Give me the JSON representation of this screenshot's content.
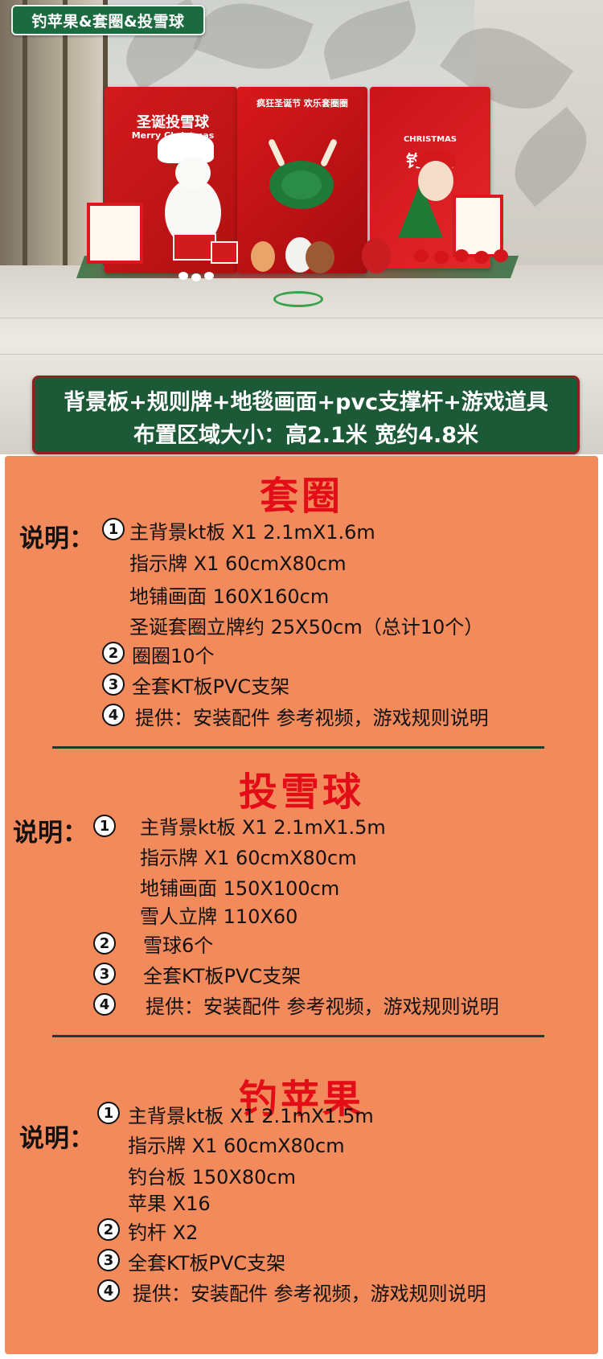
{
  "title_chip": "钓苹果&套圈&投雪球",
  "photo": {
    "board_left_title": "圣诞投雪球",
    "board_left_sub": "Merry Christmas",
    "board_mid_title": "疯狂圣诞节 欢乐套圈圈",
    "board_right_top": "CHRISTMAS",
    "board_right_title": "钓苹果"
  },
  "banner": {
    "line1": "背景板+规则牌+地毯画面+pvc支撑杆+游戏道具",
    "line2": "布置区域大小：高2.1米  宽约4.8米"
  },
  "sections": [
    {
      "title": "套圈",
      "label": "说明：",
      "items": [
        {
          "num": "1",
          "text": "主背景kt板 X1   2.1mX1.6m"
        },
        {
          "num": "",
          "text": "指示牌 X1         60cmX80cm"
        },
        {
          "num": "",
          "text": "地铺画面  160X160cm"
        },
        {
          "num": "",
          "text": "圣诞套圈立牌约  25X50cm（总计10个）"
        },
        {
          "num": "2",
          "text": "圈圈10个"
        },
        {
          "num": "3",
          "text": "全套KT板PVC支架"
        },
        {
          "num": "4",
          "text": "提供：安装配件  参考视频，游戏规则说明"
        }
      ]
    },
    {
      "title": "投雪球",
      "label": "说明：",
      "items": [
        {
          "num": "1",
          "text": "主背景kt板 X1   2.1mX1.5m"
        },
        {
          "num": "",
          "text": "指示牌 X1         60cmX80cm"
        },
        {
          "num": "",
          "text": "地铺画面  150X100cm"
        },
        {
          "num": "",
          "text": "雪人立牌  110X60"
        },
        {
          "num": "2",
          "text": "雪球6个"
        },
        {
          "num": "3",
          "text": "全套KT板PVC支架"
        },
        {
          "num": "4",
          "text": "提供：安装配件  参考视频，游戏规则说明"
        }
      ]
    },
    {
      "title": "钓苹果",
      "label": "说明：",
      "items": [
        {
          "num": "1",
          "text": "主背景kt板 X1   2.1mX1.5m"
        },
        {
          "num": "",
          "text": "指示牌 X1         60cmX80cm"
        },
        {
          "num": "",
          "text": "钓台板 150X80cm"
        },
        {
          "num": "",
          "text": "苹果  X16"
        },
        {
          "num": "2",
          "text": "钓杆 X2"
        },
        {
          "num": "3",
          "text": "全套KT板PVC支架"
        },
        {
          "num": "4",
          "text": "提供：安装配件  参考视频，游戏规则说明"
        }
      ]
    }
  ],
  "colors": {
    "panel_bg": "#f38a5c",
    "title_red": "#e30d17",
    "banner_green": "#1c5a37",
    "chip_green": "#1c6a3f"
  }
}
